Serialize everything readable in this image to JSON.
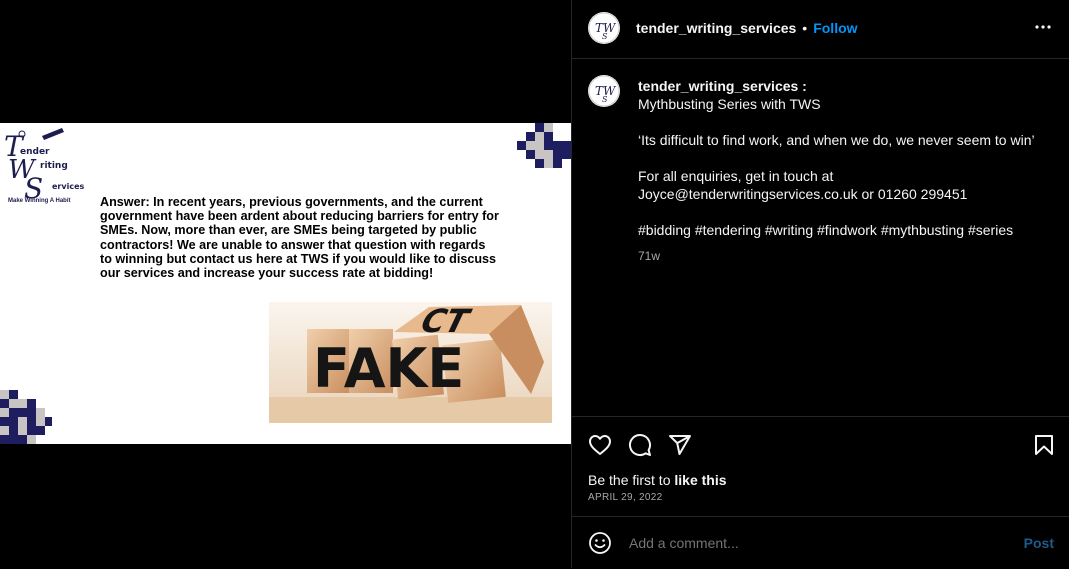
{
  "post": {
    "username": "tender_writing_services",
    "follow_label": "Follow",
    "separator": "•",
    "caption_username": "tender_writing_services :",
    "caption_lines": [
      "Mythbusting Series with TWS",
      "‘Its difficult to find work, and when we do, we never seem to win’",
      "For all enquiries, get in touch at",
      "Joyce@tenderwritingservices.co.uk or 01260 299451",
      "#bidding #tendering #writing #findwork #mythbusting #series"
    ],
    "relative_time": "71w",
    "likes_prefix": "Be the first to ",
    "likes_action": "like this",
    "date": "APRIL 29, 2022",
    "comment_placeholder": "Add a comment...",
    "post_label": "Post"
  },
  "image": {
    "logo_text": [
      "ender",
      "riting",
      "ervices"
    ],
    "logo_tagline": "Make Winning A Habit",
    "answer_text": "Answer: In recent years, previous governments, and the current government have been ardent about reducing barriers for entry for SMEs. Now, more than ever, are SMEs being targeted by public contractors!  We are unable to answer that question with regards to winning but contact us here at TWS if you would like to discuss our services and increase your success rate at bidding!",
    "dice_word_front": "FAKE",
    "dice_word_back": "CT"
  },
  "colors": {
    "link_blue": "#0095f6",
    "navy": "#1d1d5f",
    "grey_block": "#c9c4c4",
    "wood": "#d7a77c"
  },
  "icons": [
    "more-options-icon",
    "heart-icon",
    "comment-icon",
    "share-icon",
    "bookmark-icon",
    "emoji-icon"
  ]
}
